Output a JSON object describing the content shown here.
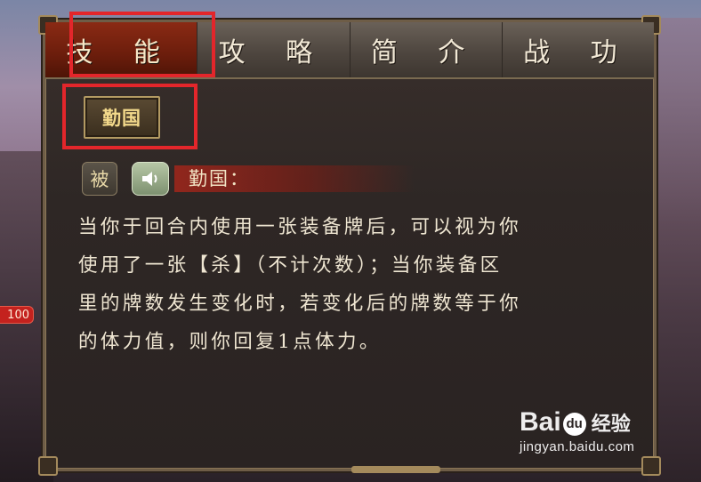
{
  "side_badge": "100",
  "tabs": [
    {
      "label": "技 能",
      "active": true
    },
    {
      "label": "攻 略",
      "active": false
    },
    {
      "label": "简 介",
      "active": false
    },
    {
      "label": "战 功",
      "active": false
    }
  ],
  "skill_button_label": "勤国",
  "skill": {
    "passive_label": "被",
    "sound_icon": "speaker-icon",
    "title": "勤国：",
    "description_lines": [
      "当你于回合内使用一张装备牌后，可以视为你",
      "使用了一张【杀】（不计次数）；当你装备区",
      "里的牌数发生变化时，若变化后的牌数等于你",
      "的体力值，则你回复1点体力。"
    ]
  },
  "watermark": {
    "brand_left": "Bai",
    "paw": "du",
    "brand_cn": "经验",
    "url": "jingyan.baidu.com"
  },
  "colors": {
    "active_tab": "#6b1d0c",
    "highlight_box": "#e3262b",
    "skill_button_text": "#f3d98b"
  }
}
